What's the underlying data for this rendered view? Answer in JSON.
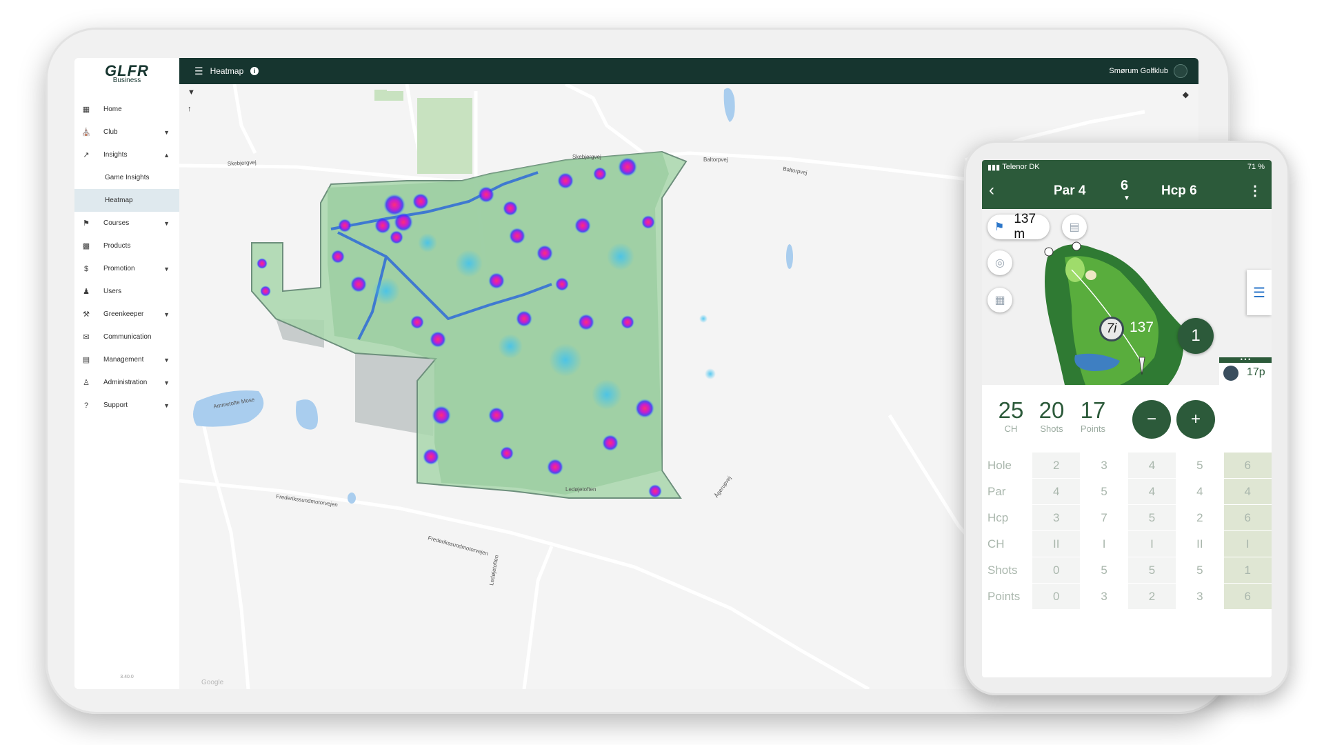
{
  "app": {
    "logo": "GLFR",
    "logo_sub": "Business",
    "version": "3.40.0"
  },
  "sidebar": {
    "items": [
      {
        "label": "Home",
        "icon": "building-icon",
        "expandable": false
      },
      {
        "label": "Club",
        "icon": "bank-icon",
        "expandable": true
      },
      {
        "label": "Insights",
        "icon": "trend-icon",
        "expandable": true,
        "expanded": true,
        "children": [
          {
            "label": "Game Insights"
          },
          {
            "label": "Heatmap",
            "active": true
          }
        ]
      },
      {
        "label": "Courses",
        "icon": "flag-icon",
        "expandable": true
      },
      {
        "label": "Products",
        "icon": "products-icon",
        "expandable": false
      },
      {
        "label": "Promotion",
        "icon": "dollar-icon",
        "expandable": true
      },
      {
        "label": "Users",
        "icon": "users-icon",
        "expandable": false
      },
      {
        "label": "Greenkeeper",
        "icon": "wrench-icon",
        "expandable": true
      },
      {
        "label": "Communication",
        "icon": "chat-icon",
        "expandable": false
      },
      {
        "label": "Management",
        "icon": "clipboard-icon",
        "expandable": true
      },
      {
        "label": "Administration",
        "icon": "person-icon",
        "expandable": true
      },
      {
        "label": "Support",
        "icon": "question-icon",
        "expandable": true
      }
    ]
  },
  "header": {
    "title": "Heatmap",
    "club": "Smørum Golfklub"
  },
  "map": {
    "attribution": "Google",
    "roads": [
      "Skebjergvej",
      "Skebjergvej",
      "Baltorpvej",
      "Baltorpvej",
      "Frederikssundmotorvejen",
      "Frederikssundmotorvejen",
      "Ledøjetoften",
      "Ledøjetoften",
      "Ågerupvej",
      "Ammetofte Mose"
    ]
  },
  "phone": {
    "status": {
      "carrier": "Telenor DK",
      "battery": "71 %"
    },
    "header": {
      "par": "Par 4",
      "hole": "6",
      "hcp": "Hcp 6"
    },
    "distance": "137 m",
    "club_label": "7i",
    "club_distance": "137",
    "hole_badge": "1",
    "player_points": "17p",
    "stats": [
      {
        "value": "25",
        "label": "CH"
      },
      {
        "value": "20",
        "label": "Shots"
      },
      {
        "value": "17",
        "label": "Points"
      }
    ],
    "minus": "−",
    "plus": "+",
    "table": {
      "rows": [
        {
          "label": "Hole",
          "cells": [
            "2",
            "3",
            "4",
            "5",
            "6"
          ]
        },
        {
          "label": "Par",
          "cells": [
            "4",
            "5",
            "4",
            "4",
            "4"
          ]
        },
        {
          "label": "Hcp",
          "cells": [
            "3",
            "7",
            "5",
            "2",
            "6"
          ]
        },
        {
          "label": "CH",
          "cells": [
            "II",
            "I",
            "I",
            "II",
            "I"
          ]
        },
        {
          "label": "Shots",
          "cells": [
            "0",
            "5",
            "5",
            "5",
            "1"
          ]
        },
        {
          "label": "Points",
          "cells": [
            "0",
            "3",
            "2",
            "3",
            "6"
          ]
        }
      ]
    }
  },
  "colors": {
    "primary": "#16352f",
    "phone_green": "#2c5a3a",
    "heat_hot": "#ff2d78",
    "heat_mid": "#3b2cff",
    "heat_low": "#3fc2f0",
    "course": "#9ccfa4"
  }
}
